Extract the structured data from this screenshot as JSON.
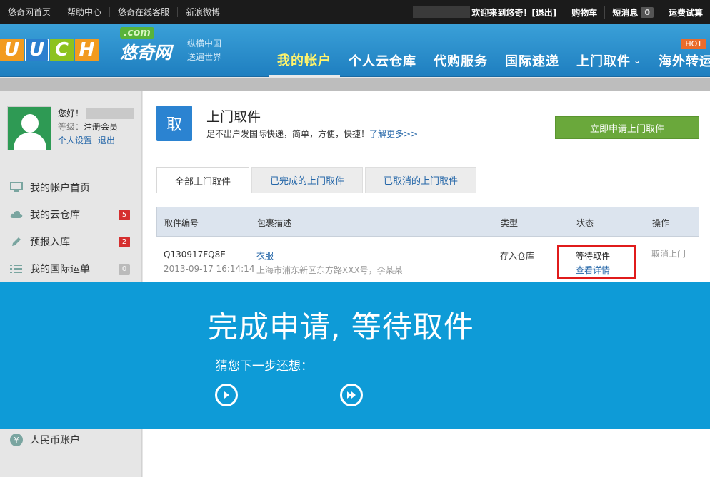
{
  "topbar": {
    "links": [
      "悠奇网首页",
      "帮助中心",
      "悠奇在线客服",
      "新浪微博"
    ],
    "welcome": "欢迎来到悠奇！[退出]",
    "cart": "购物车",
    "messages": "短消息",
    "messages_count": "0",
    "shipping_calc": "运费试算"
  },
  "header": {
    "logo_letters": [
      "U",
      "U",
      "C",
      "H"
    ],
    "logo_cn": "悠奇网",
    "logo_com": ".com",
    "slogan_line1": "纵横中国",
    "slogan_line2": "送遍世界",
    "nav": [
      "我的帐户",
      "个人云仓库",
      "代购服务",
      "国际速递",
      "上门取件",
      "海外转运"
    ],
    "hot": "HOT"
  },
  "sidebar": {
    "hello": "您好！",
    "level_label": "等级：",
    "level_value": "注册会员",
    "settings": "个人设置",
    "logout": "退出",
    "menu": [
      {
        "label": "我的帐户首页",
        "icon": "monitor-icon"
      },
      {
        "label": "我的云仓库",
        "icon": "cloud-icon",
        "count": "5"
      },
      {
        "label": "预报入库",
        "icon": "pencil-icon",
        "count": "2"
      },
      {
        "label": "我的国际运单",
        "icon": "list-icon",
        "count": "0"
      }
    ],
    "rmb_account": "人民币账户",
    "colors": {
      "badge_red": "#d52f2f",
      "badge_gray": "#bbbbbb"
    }
  },
  "main": {
    "icon_char": "取",
    "title": "上门取件",
    "subtitle": "足不出户发国际快递，简单，方便，快捷！",
    "learn_more": "了解更多>>",
    "apply_button": "立即申请上门取件",
    "tabs": [
      "全部上门取件",
      "已完成的上门取件",
      "已取消的上门取件"
    ],
    "columns": [
      "取件编号",
      "包裹描述",
      "类型",
      "状态",
      "操作"
    ],
    "row": {
      "id": "Q130917FQ8E",
      "datetime": "2013-09-17 16:14:14",
      "desc": "衣服",
      "address": "上海市浦东新区东方路XXX号，李某某",
      "type": "存入仓库",
      "status": "等待取件",
      "detail": "查看详情",
      "action": "取消上门"
    }
  },
  "banner": {
    "headline": "完成申请, 等待取件",
    "prompt": "猜您下一步还想：",
    "color": "#0e9bd7"
  }
}
